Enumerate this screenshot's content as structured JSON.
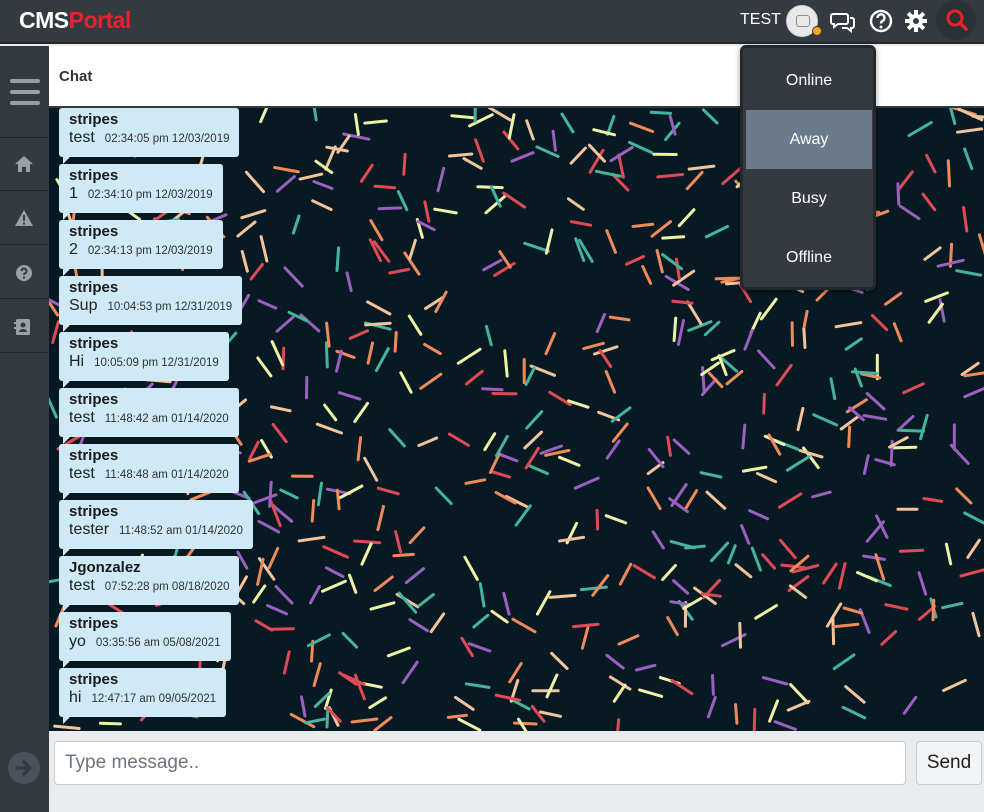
{
  "header": {
    "logo_part1": "CMS",
    "logo_part2": "Portal",
    "user_name": "TEST",
    "user_status_color": "#f5a623"
  },
  "sidebar": {
    "items": [
      {
        "icon": "hamburger-menu-icon"
      },
      {
        "icon": "home-icon"
      },
      {
        "icon": "warning-icon"
      },
      {
        "icon": "help-icon"
      },
      {
        "icon": "contact-card-icon"
      }
    ],
    "collapse_icon": "arrow-right-circle-icon"
  },
  "chat": {
    "title": "Chat",
    "messages": [
      {
        "user": "stripes",
        "text": "test",
        "time": "02:34:05 pm 12/03/2019"
      },
      {
        "user": "stripes",
        "text": "1",
        "time": "02:34:10 pm 12/03/2019"
      },
      {
        "user": "stripes",
        "text": "2",
        "time": "02:34:13 pm 12/03/2019"
      },
      {
        "user": "stripes",
        "text": "Sup",
        "time": "10:04:53 pm 12/31/2019"
      },
      {
        "user": "stripes",
        "text": "Hi",
        "time": "10:05:09 pm 12/31/2019"
      },
      {
        "user": "stripes",
        "text": "test",
        "time": "11:48:42 am 01/14/2020"
      },
      {
        "user": "stripes",
        "text": "test",
        "time": "11:48:48 am 01/14/2020"
      },
      {
        "user": "stripes",
        "text": "tester",
        "time": "11:48:52 am 01/14/2020"
      },
      {
        "user": "Jgonzalez",
        "text": "test",
        "time": "07:52:28 pm 08/18/2020"
      },
      {
        "user": "stripes",
        "text": "yo",
        "time": "03:35:56 am 05/08/2021"
      },
      {
        "user": "stripes",
        "text": "hi",
        "time": "12:47:17 am 09/05/2021"
      }
    ]
  },
  "status_menu": {
    "options": [
      "Online",
      "Away",
      "Busy",
      "Offline"
    ],
    "selected": "Away"
  },
  "composer": {
    "placeholder": "Type message..",
    "send_label": "Send"
  },
  "colors": {
    "brand_red": "#e8212a",
    "chat_bg": "#071a24",
    "bubble": "#cfe9f7",
    "topbar": "#343a40"
  }
}
